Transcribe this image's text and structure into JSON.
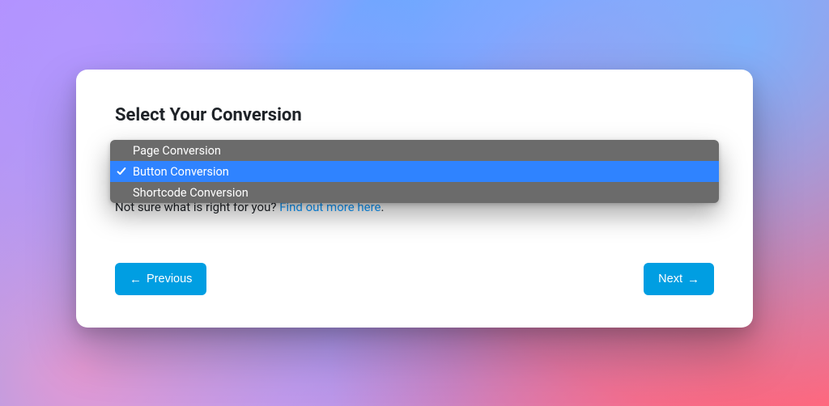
{
  "title": "Select Your Conversion",
  "select": {
    "value": "Button Conversion",
    "options": [
      {
        "label": "Page Conversion",
        "selected": false
      },
      {
        "label": "Button Conversion",
        "selected": true
      },
      {
        "label": "Shortcode Conversion",
        "selected": false
      }
    ]
  },
  "helper": {
    "prefix": "Not sure what is right for you? ",
    "link": "Find out more here",
    "suffix": "."
  },
  "buttons": {
    "previous": "Previous",
    "next": "Next"
  },
  "glyphs": {
    "arrow_left": "←",
    "arrow_right": "→"
  }
}
